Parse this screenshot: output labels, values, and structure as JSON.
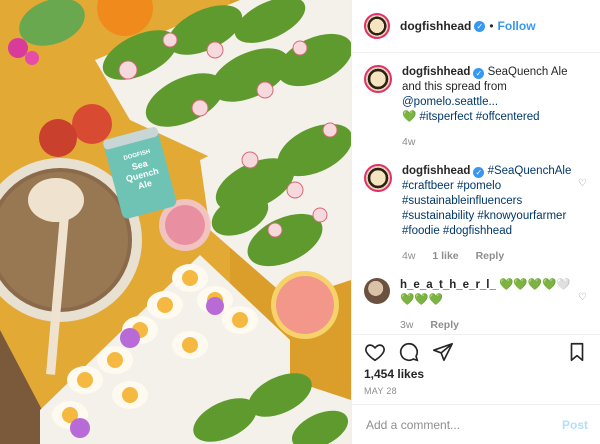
{
  "header": {
    "username": "dogfishhead",
    "separator": "•",
    "follow_label": "Follow"
  },
  "comments": [
    {
      "username": "dogfishhead",
      "text_prefix": " SeaQuench Ale and this spread from ",
      "mention": "@pomelo.seattle...",
      "line2_emoji": "💚",
      "hashtags": "#itsperfect #offcentered",
      "time": "4w"
    },
    {
      "username": "dogfishhead",
      "hashtags": "#SeaQuenchAle #craftbeer #pomelo #sustainableinfluencers #sustainability #knowyourfarmer #foodie #dogfishhead",
      "time": "4w",
      "likes": "1 like",
      "reply": "Reply"
    },
    {
      "username": "h_e_a_t_h_e_r_l_",
      "emojis": "💚💚💚💚🤍 💚💚💚",
      "time": "3w",
      "reply": "Reply"
    }
  ],
  "post": {
    "likes": "1,454 likes",
    "date": "MAY 28"
  },
  "add_comment": {
    "placeholder": "Add a comment...",
    "post_label": "Post"
  },
  "photo": {
    "can_label": "Sea Quench Ale",
    "can_brand": "DOGFISH"
  },
  "colors": {
    "accent": "#3897f0",
    "text": "#262626",
    "muted": "#8e8e8e",
    "heart_green": "#3ec43a"
  }
}
